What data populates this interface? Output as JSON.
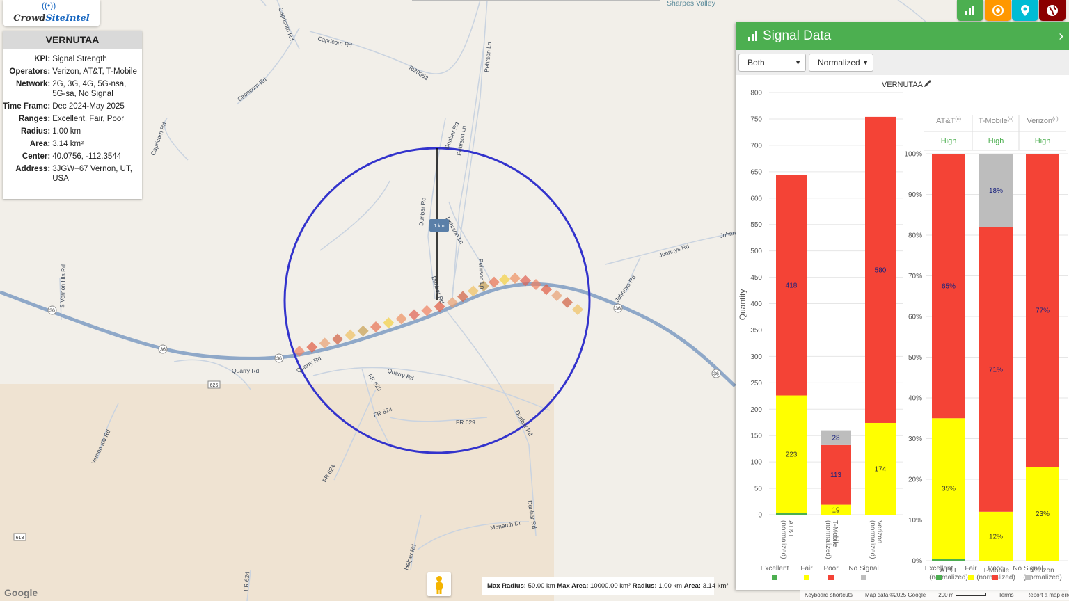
{
  "logo": {
    "text_a": "Crowd",
    "text_b": "SiteIntel"
  },
  "info": {
    "title": "VERNUTAA",
    "rows": [
      {
        "k": "KPI:",
        "v": "Signal Strength"
      },
      {
        "k": "Operators:",
        "v": "Verizon, AT&T, T-Mobile"
      },
      {
        "k": "Network:",
        "v": "2G, 3G, 4G, 5G-nsa, 5G-sa, No Signal"
      },
      {
        "k": "Time Frame:",
        "v": "Dec 2024-May 2025"
      },
      {
        "k": "Ranges:",
        "v": "Excellent, Fair, Poor"
      },
      {
        "k": "Radius:",
        "v": "1.00 km"
      },
      {
        "k": "Area:",
        "v": "3.14 km²"
      },
      {
        "k": "Center:",
        "v": "40.0756, -112.3544"
      },
      {
        "k": "Address:",
        "v": "3JGW+67 Vernon, UT, USA"
      }
    ]
  },
  "map_labels": [
    "Sharpes Valley",
    "Capricorn Rd",
    "Capricorn Rd",
    "Capricorn Rd",
    "Capricorn Rd",
    "Tc20352",
    "Pehrson Ln",
    "Dunbar Rd",
    "Pehrson Ln",
    "Dunbar Rd",
    "Pehrson Ln",
    "Pehrson Ln",
    "Dunbar Rd",
    "Johnnys Rd",
    "Johnnys Rd",
    "Johnn",
    "S Vernon Hls Rd",
    "Quarry Rd",
    "Quarry Rd",
    "Quarry Rd",
    "FR 629",
    "FR 629",
    "FR 624",
    "FR 624",
    "FR 624",
    "Vernon Kill Rd",
    "Dunbar Rd",
    "Dunbar Rd",
    "Monarch Dr",
    "Helper Rd",
    "36",
    "36",
    "36",
    "36",
    "626",
    "613"
  ],
  "scale_label": "1 km",
  "radius_bar": {
    "max_radius_label": "Max Radius:",
    "max_radius": "50.00 km",
    "max_area_label": "Max Area:",
    "max_area": "10000.00 km²",
    "radius_label": "Radius:",
    "radius": "1.00 km",
    "area_label": "Area:",
    "area": "3.14 km²"
  },
  "attribution": {
    "shortcuts": "Keyboard shortcuts",
    "data": "Map data ©2025 Google",
    "scale": "200 m",
    "terms": "Terms",
    "report": "Report a map error"
  },
  "google": "Google",
  "top_buttons": [
    {
      "name": "chart-icon",
      "color": "#4caf50"
    },
    {
      "name": "target-icon",
      "color": "#ff9800"
    },
    {
      "name": "pin-icon",
      "color": "#00bcd4"
    },
    {
      "name": "globe-icon",
      "color": "#8b0000"
    }
  ],
  "panel": {
    "title": "Signal Data",
    "select1": "Both",
    "select2": "Normalized"
  },
  "colors": {
    "excellent": "#4caf50",
    "fair": "#ffff00",
    "poor": "#f44336",
    "no_signal": "#bdbdbd",
    "circle": "#3333cc"
  },
  "chart_data": [
    {
      "type": "bar",
      "title": "VERNUTAA",
      "ylabel": "Quantity",
      "ylim": [
        0,
        800
      ],
      "yticks": [
        0,
        50,
        100,
        150,
        200,
        250,
        300,
        350,
        400,
        450,
        500,
        550,
        600,
        650,
        700,
        750,
        800
      ],
      "categories": [
        "AT&T\n(normalized)",
        "T-Mobile\n(normalized)",
        "Verizon\n(normalized)"
      ],
      "series": [
        {
          "name": "Excellent",
          "values": [
            3,
            0,
            0
          ]
        },
        {
          "name": "Fair",
          "values": [
            223,
            19,
            174
          ]
        },
        {
          "name": "Poor",
          "values": [
            418,
            113,
            580
          ]
        },
        {
          "name": "No Signal",
          "values": [
            0,
            28,
            0
          ]
        }
      ],
      "legend": [
        "Excellent",
        "Fair",
        "Poor",
        "No Signal"
      ],
      "legend_position": "bottom"
    },
    {
      "type": "bar",
      "ylim": [
        0,
        100
      ],
      "yticks": [
        "0%",
        "10%",
        "20%",
        "30%",
        "40%",
        "50%",
        "60%",
        "70%",
        "80%",
        "90%",
        "100%"
      ],
      "headers": [
        "AT&T(n)",
        "T-Mobile(n)",
        "Verizon(n)"
      ],
      "ratings": [
        "High",
        "High",
        "High"
      ],
      "categories": [
        "AT&T\n(normalized)",
        "T-Mobile\n(normalized)",
        "Verizon\n(normalized)"
      ],
      "series": [
        {
          "name": "Excellent",
          "values": [
            0.5,
            0,
            0
          ]
        },
        {
          "name": "Fair",
          "values": [
            34.5,
            12,
            23
          ]
        },
        {
          "name": "Poor",
          "values": [
            65,
            70,
            77
          ]
        },
        {
          "name": "No Signal",
          "values": [
            0,
            18,
            0
          ]
        }
      ],
      "labels": [
        {
          "Fair": "35%",
          "Poor": "65%"
        },
        {
          "Fair": "12%",
          "Poor": "71%",
          "No Signal": "18%"
        },
        {
          "Fair": "23%",
          "Poor": "77%"
        }
      ],
      "legend": [
        "Excellent",
        "Fair",
        "Poor",
        "No Signal"
      ],
      "legend_position": "bottom"
    }
  ]
}
